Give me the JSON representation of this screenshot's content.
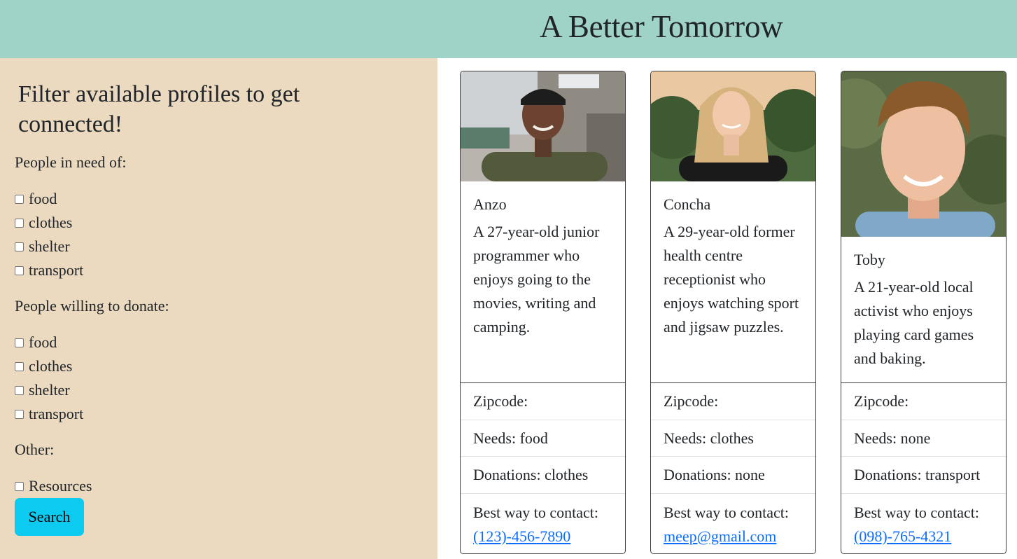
{
  "header": {
    "title": "A Better Tomorrow"
  },
  "sidebar": {
    "heading": "Filter available profiles to get connected!",
    "needs_label": "People in need of:",
    "needs": [
      "food",
      "clothes",
      "shelter",
      "transport"
    ],
    "donate_label": "People willing to donate:",
    "donate": [
      "food",
      "clothes",
      "shelter",
      "transport"
    ],
    "other_label": "Other:",
    "other": [
      "Resources"
    ],
    "search_label": "Search"
  },
  "profiles": [
    {
      "name": "Anzo",
      "description": "A 27-year-old junior programmer who enjoys going to the movies, writing and camping.",
      "zipcode": "Zipcode:",
      "needs": "Needs: food",
      "donations": "Donations: clothes",
      "contact_label": "Best way to contact:",
      "contact": "(123)-456-7890"
    },
    {
      "name": "Concha",
      "description": "A 29-year-old former health centre receptionist who enjoys watching sport and jigsaw puzzles.",
      "zipcode": "Zipcode:",
      "needs": "Needs: clothes",
      "donations": "Donations: none",
      "contact_label": "Best way to contact:",
      "contact": "meep@gmail.com"
    },
    {
      "name": "Toby",
      "description": "A 21-year-old local activist who enjoys playing card games and baking.",
      "zipcode": "Zipcode:",
      "needs": "Needs: none",
      "donations": "Donations: transport",
      "contact_label": "Best way to contact:",
      "contact": "(098)-765-4321"
    }
  ]
}
